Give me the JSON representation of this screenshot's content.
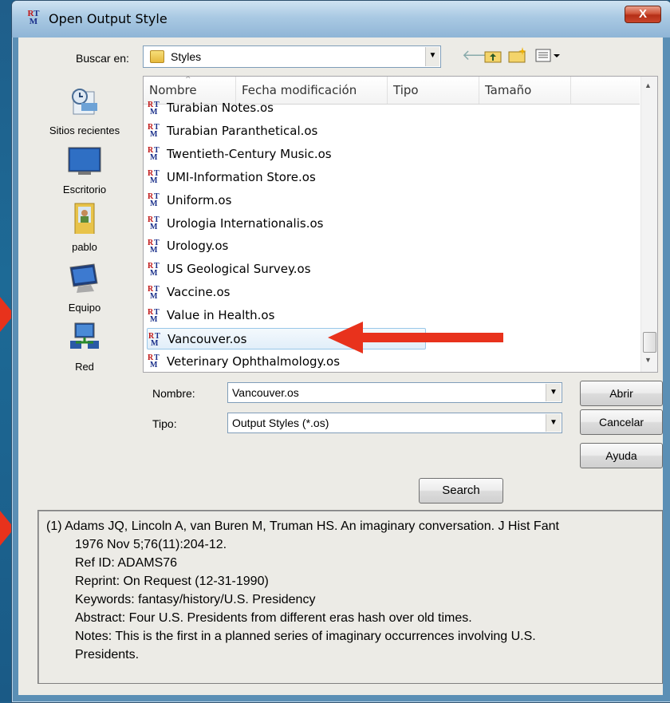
{
  "window": {
    "title": "Open Output Style",
    "close_label": "X"
  },
  "look_in": {
    "label": "Buscar en:",
    "value": "Styles"
  },
  "places": [
    {
      "label": "Sitios recientes",
      "icon": "recent-places-icon"
    },
    {
      "label": "Escritorio",
      "icon": "desktop-icon"
    },
    {
      "label": "pablo",
      "icon": "user-folder-icon"
    },
    {
      "label": "Equipo",
      "icon": "computer-icon"
    },
    {
      "label": "Red",
      "icon": "network-icon"
    }
  ],
  "columns": [
    "Nombre",
    "Fecha modificación",
    "Tipo",
    "Tamaño"
  ],
  "files": [
    {
      "name": "Turabian Notes.os"
    },
    {
      "name": "Turabian Paranthetical.os"
    },
    {
      "name": "Twentieth-Century Music.os"
    },
    {
      "name": "UMI-Information Store.os"
    },
    {
      "name": "Uniform.os"
    },
    {
      "name": "Urologia Internationalis.os"
    },
    {
      "name": "Urology.os"
    },
    {
      "name": "US Geological Survey.os"
    },
    {
      "name": "Vaccine.os"
    },
    {
      "name": "Value in Health.os"
    },
    {
      "name": "Vancouver.os"
    },
    {
      "name": "Veterinary Ophthalmology.os"
    }
  ],
  "selected_index": 10,
  "name_field": {
    "label": "Nombre:",
    "value": "Vancouver.os"
  },
  "type_field": {
    "label": "Tipo:",
    "value": "Output Styles (*.os)"
  },
  "buttons": {
    "open": "Abrir",
    "cancel": "Cancelar",
    "help": "Ayuda",
    "search": "Search"
  },
  "preview": {
    "lines": [
      "(1)  Adams JQ, Lincoln A, van Buren M, Truman HS. An imaginary conversation. J Hist Fant",
      "1976 Nov 5;76(11):204-12.",
      "Ref ID: ADAMS76",
      "Reprint: On Request (12-31-1990)",
      "Keywords: fantasy/history/U.S. Presidency",
      "Abstract: Four U.S. Presidents from different eras hash over old times.",
      "Notes: This is the first in a planned series of imaginary occurrences involving U.S.",
      "Presidents."
    ]
  },
  "colors": {
    "annotation_arrow": "#e8321c",
    "selection_border": "#99c7e8"
  }
}
